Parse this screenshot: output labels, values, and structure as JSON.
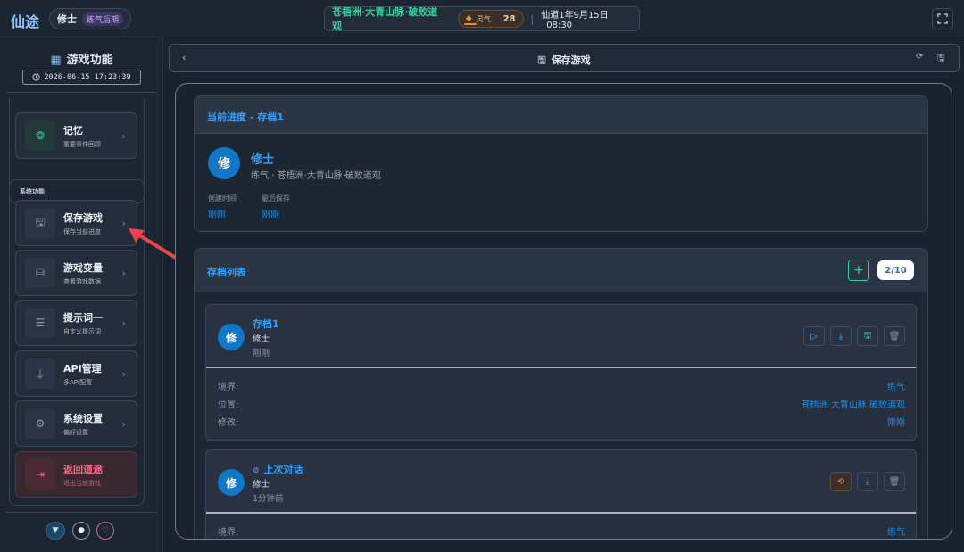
{
  "topbar": {
    "app_name": "仙途",
    "user": {
      "name": "修士",
      "rank": "练气后期"
    },
    "location": "苍梧洲·大青山脉·破败道观",
    "qi": {
      "label": "灵气",
      "value": "28"
    },
    "date": "仙道1年9月15日",
    "time": "08:30"
  },
  "sidebar": {
    "title": "游戏功能",
    "clock": "2026-06-15 17:23:39",
    "memory_item": {
      "title": "记忆",
      "subtitle": "重要事件回顾"
    },
    "group_title": "系统功能",
    "items": [
      {
        "title": "保存游戏",
        "subtitle": "保存当前进度"
      },
      {
        "title": "游戏变量",
        "subtitle": "查看游戏数据"
      },
      {
        "title": "提示词一",
        "subtitle": "自定义提示词"
      },
      {
        "title": "API管理",
        "subtitle": "多API配置"
      },
      {
        "title": "系统设置",
        "subtitle": "偏好设置"
      },
      {
        "title": "返回道途",
        "subtitle": "退出当前游戏"
      }
    ]
  },
  "header": {
    "back_label": "‹",
    "title": "保存游戏"
  },
  "current": {
    "title": "当前进度 - 存档1",
    "avatar": "修",
    "name": "修士",
    "subtitle": "练气 · 苍梧洲·大青山脉·破败道观",
    "created_label": "创建时间",
    "created_value": "刚刚",
    "saved_label": "最后保存",
    "saved_value": "刚刚"
  },
  "save_list": {
    "title": "存档列表",
    "add_label": "+",
    "count": "2/10",
    "saves": [
      {
        "avatar": "修",
        "name": "存档1",
        "role": "修士",
        "time": "刚刚",
        "details": [
          {
            "label": "境界:",
            "value": "练气"
          },
          {
            "label": "位置:",
            "value": "苍梧洲·大青山脉·破败道观"
          },
          {
            "label": "修改:",
            "value": "刚刚"
          }
        ]
      },
      {
        "avatar": "修",
        "name": "上次对话",
        "role": "修士",
        "time": "1分钟前",
        "details": [
          {
            "label": "境界:",
            "value": "练气"
          }
        ]
      }
    ]
  },
  "colors": {
    "accent": "#2fa2ff",
    "green": "#34d39a",
    "danger": "#ff6b81",
    "qi": "#e7922e"
  }
}
